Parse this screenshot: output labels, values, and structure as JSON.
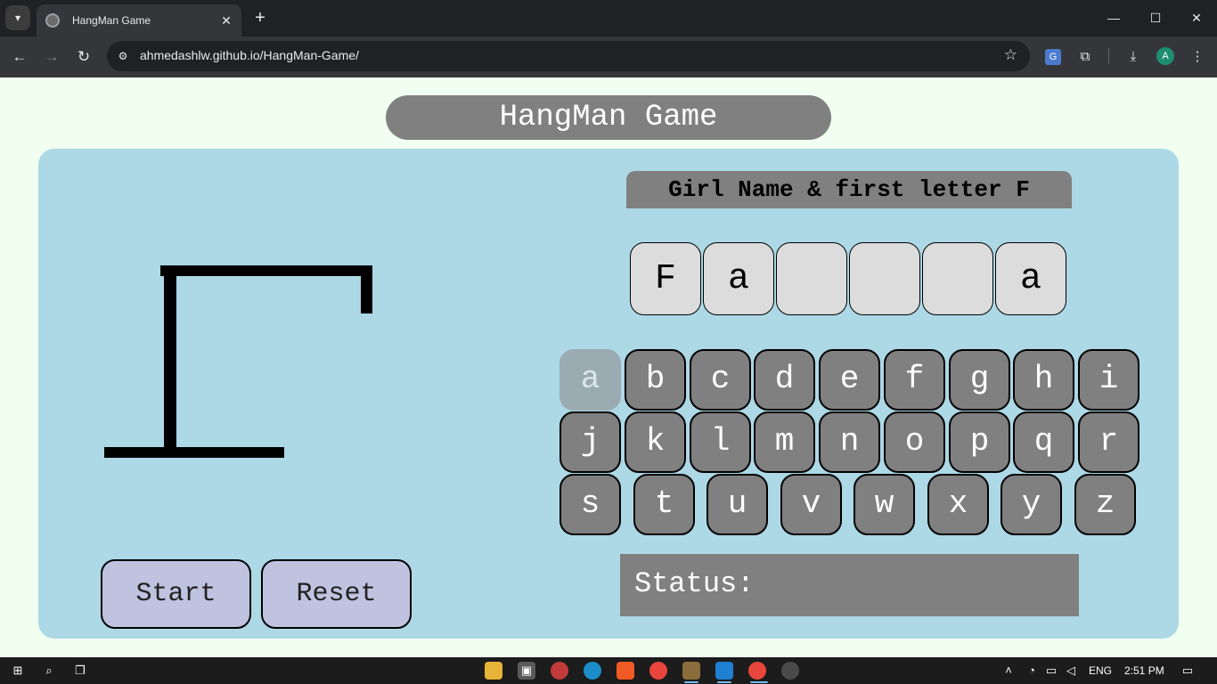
{
  "browser": {
    "tab_title": "HangMan Game",
    "url": "ahmedashlw.github.io/HangMan-Game/",
    "profile_initial": "A",
    "icons": [
      "tab-search-icon",
      "close-icon",
      "new-tab-icon",
      "minimize-icon",
      "maximize-icon",
      "window-close-icon",
      "back-icon",
      "forward-icon",
      "reload-icon",
      "site-info-icon",
      "star-icon",
      "translate-icon",
      "extensions-icon",
      "download-icon",
      "menu-icon"
    ]
  },
  "game": {
    "title": "HangMan Game",
    "hint": "Girl Name & first letter F",
    "word": [
      "F",
      "a",
      "",
      "",
      "",
      "a"
    ],
    "keys_row1": [
      "a",
      "b",
      "c",
      "d",
      "e",
      "f",
      "g",
      "h",
      "i"
    ],
    "keys_row2": [
      "j",
      "k",
      "l",
      "m",
      "n",
      "o",
      "p",
      "q",
      "r"
    ],
    "keys_row3": [
      "s",
      "t",
      "u",
      "v",
      "w",
      "x",
      "y",
      "z"
    ],
    "used_letters": [
      "a"
    ],
    "status_label": "Status:",
    "start_label": "Start",
    "reset_label": "Reset"
  },
  "taskbar": {
    "language": "ENG",
    "time": "2:51 PM"
  },
  "colors": {
    "page_bg": "#f0fff0",
    "panel_bg": "#add8e6",
    "key_bg": "#808080",
    "key_used_bg": "#9aabb1",
    "button_bg": "#bfc3df"
  }
}
